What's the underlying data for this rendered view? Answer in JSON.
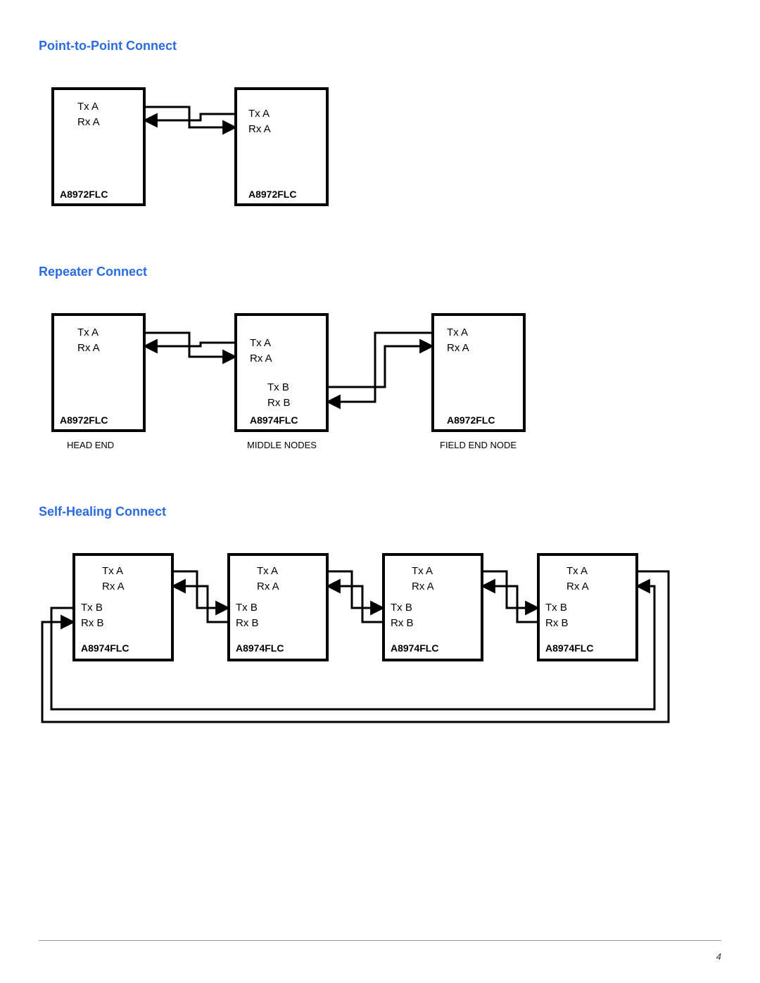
{
  "page_number": "4",
  "sections": {
    "ptp": {
      "title": "Point-to-Point Connect",
      "nodes": [
        {
          "model": "A8972FLC",
          "ports": [
            "Tx  A",
            "Rx  A"
          ]
        },
        {
          "model": "A8972FLC",
          "ports": [
            "Tx  A",
            "Rx  A"
          ]
        }
      ]
    },
    "repeater": {
      "title": "Repeater Connect",
      "nodes": [
        {
          "model": "A8972FLC",
          "role": "HEAD END",
          "ports": [
            "Tx  A",
            "Rx  A"
          ]
        },
        {
          "model": "A8974FLC",
          "role": "MIDDLE NODES",
          "ports": [
            "Tx  A",
            "Rx  A",
            "Tx   B",
            "Rx  B"
          ]
        },
        {
          "model": "A8972FLC",
          "role": "FIELD END NODE",
          "ports": [
            "Tx  A",
            "Rx  A"
          ]
        }
      ]
    },
    "selfheal": {
      "title": "Self-Healing Connect",
      "nodes": [
        {
          "model": "A8974FLC",
          "ports": [
            "Tx  A",
            "Rx  A",
            "Tx   B",
            "Rx  B"
          ]
        },
        {
          "model": "A8974FLC",
          "ports": [
            "Tx  A",
            "Rx  A",
            "Tx   B",
            "Rx  B"
          ]
        },
        {
          "model": "A8974FLC",
          "ports": [
            "Tx  A",
            "Rx  A",
            "Tx   B",
            "Rx  B"
          ]
        },
        {
          "model": "A8974FLC",
          "ports": [
            "Tx  A",
            "Rx  A",
            "Tx   B",
            "Rx  B"
          ]
        }
      ]
    }
  }
}
